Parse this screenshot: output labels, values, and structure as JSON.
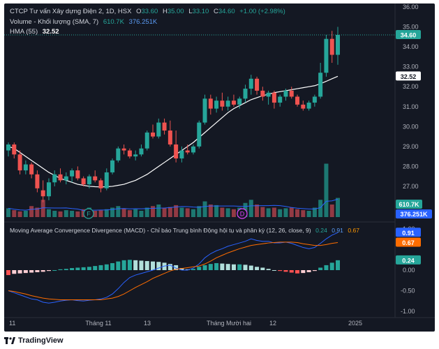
{
  "title_line": {
    "symbol": "CTCP Tư vấn Xây dựng Điện 2, 1D, HSX",
    "o_label": "O",
    "o": "33.60",
    "h_label": "H",
    "h": "35.00",
    "l_label": "L",
    "l": "33.10",
    "c_label": "C",
    "c": "34.60",
    "change": "+1.00 (+2.98%)"
  },
  "volume_line": {
    "label": "Volume - Khối lượng (SMA, 7)",
    "v1": "610.7K",
    "v2": "376.251K"
  },
  "hma_line": {
    "label": "HMA (55)",
    "value": "32.52"
  },
  "macd_line": {
    "label": "Moving Average Convergence Divergence (MACD) - Chỉ báo Trung bình Động hội tụ và phân kỳ (12, 26, close, 9)",
    "v1": "0.24",
    "v2": "0.91",
    "v3": "0.67"
  },
  "price_axis": [
    "36.00",
    "35.00",
    "34.60",
    "34.00",
    "33.00",
    "32.52",
    "32.00",
    "31.00",
    "30.00",
    "29.00",
    "28.00",
    "27.00"
  ],
  "volume_badges": [
    "610.7K",
    "376.251K"
  ],
  "macd_axis": [
    "1.00",
    "0.91",
    "0.67",
    "0.24",
    "0.00",
    "-0.50",
    "-1.00"
  ],
  "time_axis": [
    "11",
    "Tháng 11",
    "13",
    "Tháng Mười hai",
    "12",
    "2025"
  ],
  "markers": [
    "F",
    "D"
  ],
  "footer": {
    "brand": "TradingView"
  },
  "colors": {
    "up": "#26a69a",
    "down": "#ef5350",
    "bg": "#141823",
    "text": "#d1d4dc",
    "hma": "#ffffff",
    "macd": "#2962ff",
    "signal": "#ff6d00"
  },
  "chart_data": {
    "type": "candlestick",
    "ylim": [
      26.3,
      36.0
    ],
    "series": [
      {
        "name": "OHLC",
        "values": [
          [
            28.8,
            29.2,
            28.5,
            29.1
          ],
          [
            29.1,
            29.2,
            28.4,
            28.6
          ],
          [
            28.6,
            28.8,
            27.6,
            27.8
          ],
          [
            27.8,
            28.3,
            27.6,
            28.1
          ],
          [
            28.1,
            28.2,
            27.4,
            27.6
          ],
          [
            27.6,
            27.8,
            26.7,
            26.9
          ],
          [
            26.8,
            27.3,
            26.2,
            26.5
          ],
          [
            26.5,
            27.4,
            26.3,
            27.2
          ],
          [
            27.2,
            27.8,
            27.0,
            27.6
          ],
          [
            27.6,
            27.9,
            27.2,
            27.3
          ],
          [
            27.3,
            27.7,
            27.1,
            27.5
          ],
          [
            27.5,
            27.9,
            27.2,
            27.8
          ],
          [
            27.8,
            28.0,
            27.3,
            27.4
          ],
          [
            27.4,
            27.5,
            27.0,
            27.1
          ],
          [
            27.1,
            27.6,
            26.9,
            27.5
          ],
          [
            27.5,
            27.8,
            27.2,
            27.3
          ],
          [
            27.3,
            27.4,
            26.7,
            26.9
          ],
          [
            26.9,
            27.9,
            26.8,
            27.7
          ],
          [
            27.7,
            28.4,
            27.6,
            28.3
          ],
          [
            28.3,
            29.0,
            28.2,
            28.9
          ],
          [
            28.9,
            29.1,
            28.6,
            28.8
          ],
          [
            28.8,
            28.9,
            28.4,
            28.5
          ],
          [
            28.5,
            28.8,
            28.3,
            28.6
          ],
          [
            28.6,
            29.1,
            28.5,
            28.9
          ],
          [
            28.9,
            29.8,
            28.8,
            29.7
          ],
          [
            29.7,
            30.1,
            29.4,
            29.5
          ],
          [
            29.5,
            30.4,
            29.4,
            30.2
          ],
          [
            30.2,
            30.4,
            29.6,
            29.8
          ],
          [
            29.8,
            30.3,
            29.0,
            29.1
          ],
          [
            29.1,
            29.8,
            28.2,
            28.4
          ],
          [
            28.4,
            29.0,
            28.2,
            28.8
          ],
          [
            28.8,
            29.1,
            28.6,
            28.7
          ],
          [
            28.7,
            29.1,
            28.6,
            29.0
          ],
          [
            29.0,
            30.3,
            28.9,
            30.2
          ],
          [
            30.2,
            31.6,
            30.1,
            31.4
          ],
          [
            31.4,
            31.6,
            30.6,
            30.9
          ],
          [
            30.9,
            31.5,
            30.7,
            31.3
          ],
          [
            31.3,
            31.7,
            30.8,
            31.0
          ],
          [
            31.0,
            31.5,
            30.8,
            31.3
          ],
          [
            31.3,
            31.6,
            31.0,
            31.1
          ],
          [
            31.1,
            31.5,
            30.9,
            31.4
          ],
          [
            31.4,
            32.1,
            31.2,
            31.9
          ],
          [
            31.9,
            32.6,
            31.6,
            32.4
          ],
          [
            32.4,
            32.5,
            31.6,
            31.8
          ],
          [
            31.8,
            32.0,
            31.3,
            31.5
          ],
          [
            31.5,
            31.8,
            31.1,
            31.7
          ],
          [
            31.7,
            31.8,
            30.9,
            31.2
          ],
          [
            31.2,
            31.6,
            31.0,
            31.5
          ],
          [
            31.5,
            31.9,
            31.3,
            31.8
          ],
          [
            31.8,
            32.0,
            31.4,
            31.5
          ],
          [
            31.5,
            31.6,
            31.0,
            31.1
          ],
          [
            31.1,
            31.3,
            30.8,
            30.9
          ],
          [
            30.9,
            31.3,
            30.8,
            31.2
          ],
          [
            31.2,
            31.6,
            31.0,
            31.5
          ],
          [
            31.5,
            33.2,
            31.4,
            32.7
          ],
          [
            32.7,
            34.6,
            32.5,
            34.4
          ],
          [
            34.4,
            34.8,
            33.2,
            33.6
          ],
          [
            33.6,
            35.0,
            33.1,
            34.6
          ]
        ]
      },
      {
        "name": "Volume",
        "values": [
          0.28,
          0.22,
          0.18,
          0.2,
          0.35,
          0.3,
          0.55,
          0.25,
          0.2,
          0.18,
          0.22,
          0.2,
          0.18,
          0.25,
          0.3,
          0.2,
          0.22,
          0.25,
          0.3,
          0.35,
          0.28,
          0.22,
          0.25,
          0.2,
          0.3,
          0.35,
          0.4,
          0.3,
          0.32,
          0.38,
          0.3,
          0.28,
          0.25,
          0.35,
          0.5,
          0.4,
          0.38,
          0.3,
          0.28,
          0.25,
          0.3,
          0.45,
          0.55,
          0.4,
          0.32,
          0.28,
          0.3,
          0.25,
          0.28,
          0.3,
          0.25,
          0.22,
          0.2,
          0.3,
          0.55,
          1.7,
          0.4,
          0.61
        ]
      }
    ]
  }
}
